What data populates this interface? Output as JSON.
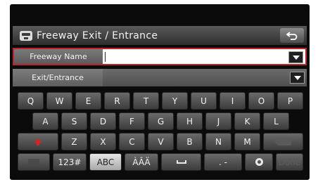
{
  "header": {
    "title": "Freeway Exit / Entrance",
    "title_icon": "highway-icon",
    "back_icon": "back-arrow-icon"
  },
  "fields": {
    "freeway_name": {
      "label": "Freeway Name",
      "value": ""
    },
    "exit_entrance": {
      "label": "Exit/Entrance",
      "value": ""
    }
  },
  "keyboard": {
    "row1": [
      "Q",
      "W",
      "E",
      "R",
      "T",
      "Y",
      "U",
      "I",
      "O",
      "P"
    ],
    "row2": [
      "A",
      "S",
      "D",
      "F",
      "G",
      "H",
      "J",
      "K",
      "L"
    ],
    "row3": [
      "Z",
      "X",
      "C",
      "V",
      "B",
      "N",
      "M"
    ],
    "bottom": {
      "numeric": "123#",
      "alpha": "ABC",
      "accent": "ÀÂÄ",
      "punct": ". -",
      "done": "Done"
    }
  },
  "colors": {
    "accent_red": "#c0242b"
  }
}
